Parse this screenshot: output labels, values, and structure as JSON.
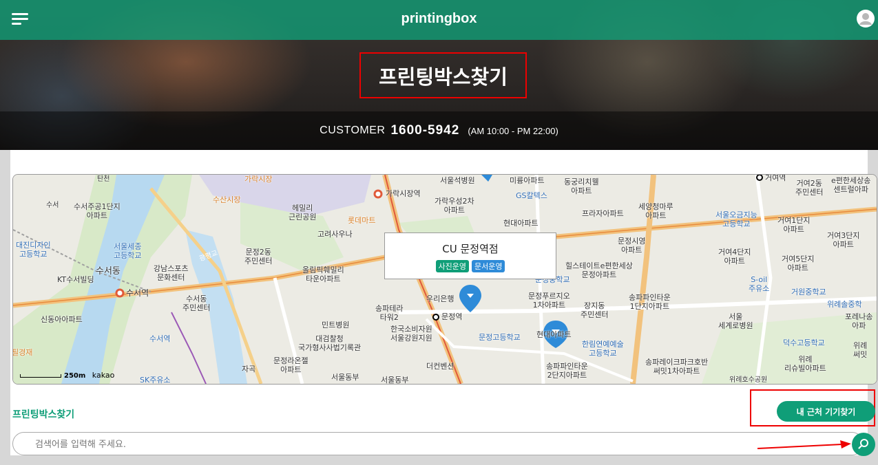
{
  "header": {
    "brand": "printingbox",
    "title": "프린팅박스찾기",
    "customer_label": "CUSTOMER",
    "customer_phone": "1600-5942",
    "customer_hours": "(AM 10:00 - PM 22:00)"
  },
  "map": {
    "popup": {
      "title": "CU 문정역점",
      "tags": [
        {
          "label": "사진운영",
          "color": "#0f9e78"
        },
        {
          "label": "문서운영",
          "color": "#2e8bd8"
        }
      ]
    },
    "scale_label": "250m",
    "provider": "kakao",
    "labels": {
      "l1": "가락시장",
      "l2": "수산시장",
      "l3": "가락시장역",
      "l4": "서울석병원",
      "l5": "미륭아파트",
      "l6": "동궁리치웰\n아파트",
      "l7": "거여역",
      "l8": "거여2동\n주민센터",
      "l9": "e편한세상송\n센트럴아파",
      "l10": "수서주공1단지\n아파트",
      "l11": "헤밀리\n근린공원",
      "l12": "롯데마트",
      "l13": "가락우성2차\n아파트",
      "l14": "GS칼텍스",
      "l15": "프라자아파트",
      "l16": "세양청마루\n아파트",
      "l17": "서울오금지능\n고등학교",
      "l18": "거여1단지\n아파트",
      "l19": "대진디자인\n고등학교",
      "l20": "서울세종\n고등학교",
      "l21": "고려사우나",
      "l22": "문정2동\n주민센터",
      "l23": "현대아파트",
      "l24": "문정시영\n아파트",
      "l25": "거여3단지\n아파트",
      "l26": "수서동",
      "l27": "강남스포츠\n문화센터",
      "l28": "올림픽훼밀리\n타운아파트",
      "l29": "힐스테이트e편한세상\n문정아파트",
      "l30": "거여4단지\n아파트",
      "l31": "거여5단지\n아파트",
      "l32": "KT수서빌딩",
      "l33": "문정중학교",
      "l34": "S-oil\n주유소",
      "l35": "거원중학교",
      "l36": "수서역",
      "l37": "수서동\n주민센터",
      "l38": "우리은행",
      "l39": "문정푸르지오\n1차아파트",
      "l40": "장지동\n주민센터",
      "l41": "송파파인타운\n1단지아파트",
      "l42": "위례솔중학",
      "l43": "신동아아파트",
      "l44": "송파테라\n타워2",
      "l45": "문정역",
      "l46": "서울\n세계로병원",
      "l47": "포레나송\n아파",
      "l48": "민트병원",
      "l49": "문정고등학교",
      "l50": "현대아파트",
      "l51": "대검찰청\n국가형사사법기록관",
      "l52": "한국소비자원\n서울강원지원",
      "l53": "한림연예예술\n고등학교",
      "l54": "덕수고등학교",
      "l55": "필경재",
      "l56": "수서역",
      "l57": "문정라온젤\n아파트",
      "l58": "더컨벤션",
      "l59": "송파레이크파크호반\n써밋1차아파트",
      "l60": "위례\n리슈빌아파트",
      "l61": "자곡",
      "l62": "송파파인타운\n2단지아파트",
      "l63": "서울동부",
      "l64": "서울동부",
      "l65": "SK주유소",
      "l66": "광평교",
      "l67": "탄천",
      "l68": "수서",
      "l69": "위례호수공원",
      "l70": "위례\n써밋"
    }
  },
  "section_title": "프린팅박스찾기",
  "near_button": "내 근처 기기찾기",
  "search": {
    "placeholder": "검색어를 입력해 주세요."
  }
}
